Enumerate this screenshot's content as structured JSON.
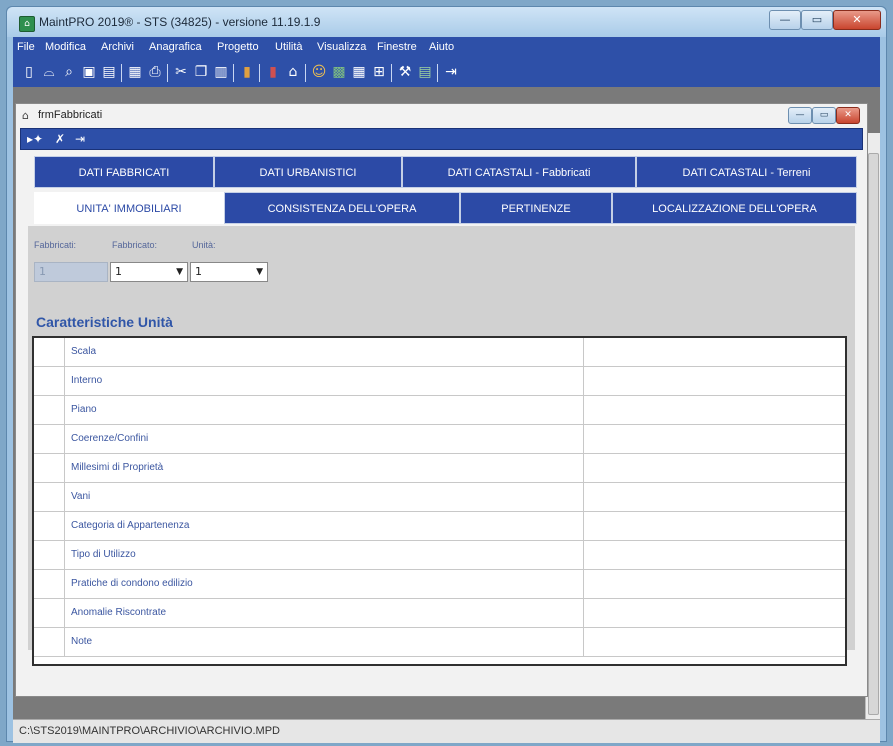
{
  "window": {
    "title": "MaintPRO 2019® - STS (34825) - versione 11.19.1.9",
    "icon": "app-icon",
    "controls": [
      "minimize-icon",
      "maximize-icon",
      "close-icon"
    ]
  },
  "menu": {
    "items": [
      "File",
      "Modifica",
      "Archivi",
      "Anagrafica",
      "Progetto",
      "Utilità",
      "Visualizza",
      "Finestre",
      "Aiuto"
    ]
  },
  "toolbar": {
    "icons": [
      "new-icon",
      "open-icon",
      "search-icon",
      "save-icon",
      "save-all-icon",
      "print-setup-icon",
      "print-icon",
      "cut-icon",
      "copy-icon",
      "paste-icon",
      "library-icon",
      "archive-icon",
      "home-icon",
      "users-icon",
      "image-icon",
      "grid-icon",
      "chart-icon",
      "tools-icon",
      "calc-icon",
      "exit-icon"
    ]
  },
  "child": {
    "title": "frmFabbricati",
    "toolbar_icons": [
      "next-record-icon",
      "cancel-icon",
      "exit-icon"
    ]
  },
  "tabs": {
    "row1": [
      "DATI FABBRICATI",
      "DATI URBANISTICI",
      "DATI CATASTALI - Fabbricati",
      "DATI CATASTALI - Terreni"
    ],
    "row2": [
      "UNITA' IMMOBILIARI",
      "CONSISTENZA DELL'OPERA",
      "PERTINENZE",
      "LOCALIZZAZIONE DELL'OPERA"
    ],
    "active": "UNITA' IMMOBILIARI"
  },
  "filters": {
    "fabbricati_label": "Fabbricati:",
    "fabbricati_value": "1",
    "fabbricato_label": "Fabbricato:",
    "fabbricato_value": "1",
    "unita_label": "Unità:",
    "unita_value": "1"
  },
  "section": {
    "title": "Caratteristiche Unità"
  },
  "grid": {
    "rows": [
      {
        "label": "Scala",
        "value": ""
      },
      {
        "label": "Interno",
        "value": ""
      },
      {
        "label": "Piano",
        "value": ""
      },
      {
        "label": "Coerenze/Confini",
        "value": ""
      },
      {
        "label": "Millesimi di Proprietà",
        "value": ""
      },
      {
        "label": "Vani",
        "value": ""
      },
      {
        "label": "Categoria di Appartenenza",
        "value": ""
      },
      {
        "label": "Tipo di Utilizzo",
        "value": ""
      },
      {
        "label": "Pratiche di condono edilizio",
        "value": ""
      },
      {
        "label": "Anomalie Riscontrate",
        "value": ""
      },
      {
        "label": "Note",
        "value": ""
      }
    ]
  },
  "status": {
    "path": "C:\\STS2019\\MAINTPRO\\ARCHIVIO\\ARCHIVIO.MPD"
  }
}
